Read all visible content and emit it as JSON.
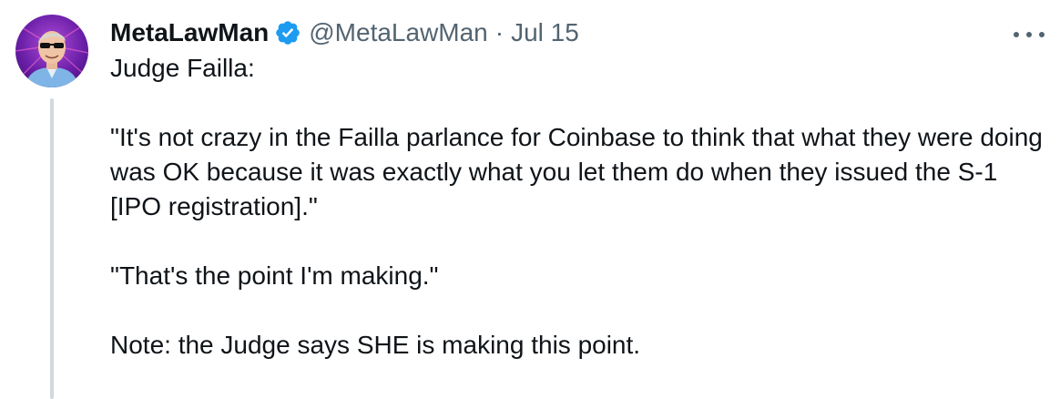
{
  "tweet": {
    "display_name": "MetaLawMan",
    "handle": "@MetaLawMan",
    "separator": "·",
    "date": "Jul 15",
    "verified_icon": "verified-badge-icon",
    "more_icon": "more-options-icon",
    "paragraphs": [
      "Judge Failla:",
      "\"It's not crazy in the Failla parlance for Coinbase to think that what they were doing was OK because it was exactly what you let them do when they issued the S-1 [IPO registration].\"",
      "\"That's the point I'm making.\"",
      "Note: the Judge says SHE is making this point."
    ]
  },
  "colors": {
    "text_primary": "#0f1419",
    "text_secondary": "#536471",
    "verified_blue": "#1d9bf0",
    "thread_line": "#cfd9de"
  }
}
